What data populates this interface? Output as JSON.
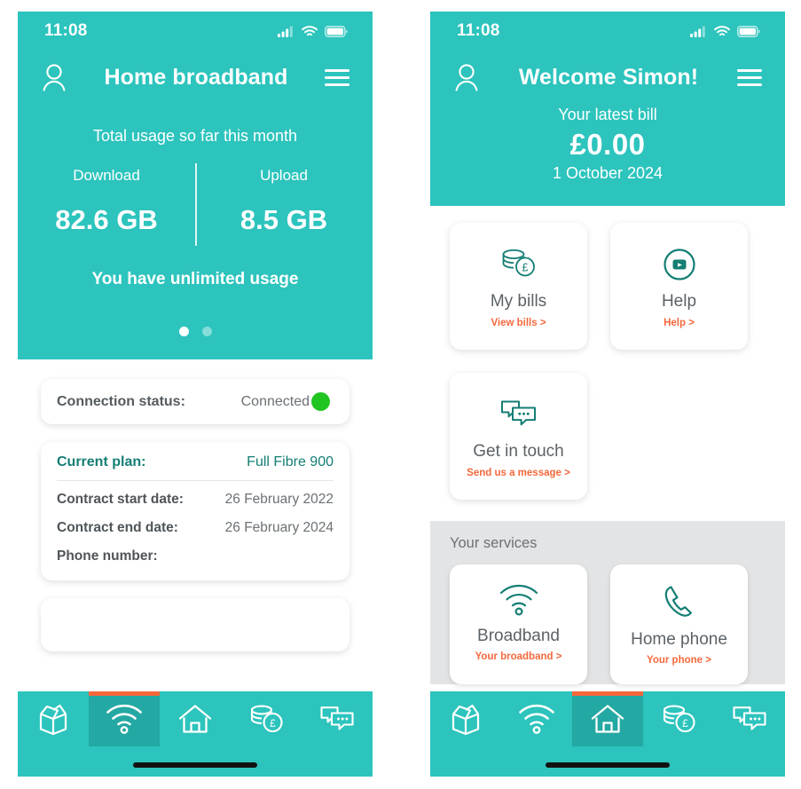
{
  "colors": {
    "teal": "#2cc4bd",
    "teal_dark": "#24a8a3",
    "icon_teal": "#147e74",
    "orange": "#f4683c",
    "green_led": "#21c521",
    "grey_band": "#e3e4e5",
    "text_grey": "#6b7175"
  },
  "left_phone": {
    "status_bar": {
      "time": "11:08",
      "icons": [
        "signal-icon",
        "wifi-icon",
        "battery-icon"
      ]
    },
    "nav": {
      "account_icon": "person-icon",
      "title": "Home broadband",
      "menu_icon": "hamburger-icon"
    },
    "usage": {
      "caption": "Total usage so far this month",
      "download_label": "Download",
      "download_value": "82.6 GB",
      "upload_label": "Upload",
      "upload_value": "8.5 GB",
      "unlimited_note": "You have unlimited usage",
      "carousel_dots": 2,
      "carousel_active_index": 0
    },
    "connection": {
      "label": "Connection status:",
      "value": "Connected",
      "led_state": "green"
    },
    "plan": {
      "plan_label": "Current plan:",
      "plan_value": "Full Fibre 900",
      "rows": [
        {
          "label": "Contract start date:",
          "value": "26 February 2022"
        },
        {
          "label": "Contract end date:",
          "value": "26 February 2024"
        },
        {
          "label": "Phone number:",
          "value": ""
        }
      ]
    },
    "tabbar": {
      "items": [
        {
          "name": "tab-products",
          "icon": "open-box-icon",
          "active": false
        },
        {
          "name": "tab-broadband",
          "icon": "wifi-icon",
          "active": true
        },
        {
          "name": "tab-home",
          "icon": "house-icon",
          "active": false
        },
        {
          "name": "tab-bills",
          "icon": "coins-pound-icon",
          "active": false
        },
        {
          "name": "tab-messages",
          "icon": "chat-bubbles-icon",
          "active": false
        }
      ]
    }
  },
  "right_phone": {
    "status_bar": {
      "time": "11:08",
      "icons": [
        "signal-icon",
        "wifi-icon",
        "battery-icon"
      ]
    },
    "nav": {
      "account_icon": "person-icon",
      "title": "Welcome Simon!",
      "menu_icon": "hamburger-icon"
    },
    "bill": {
      "caption": "Your latest bill",
      "amount": "£0.00",
      "date": "1 October 2024"
    },
    "tiles": [
      {
        "icon": "coins-pound-icon",
        "title": "My bills",
        "link": "View bills >"
      },
      {
        "icon": "play-circle-icon",
        "title": "Help",
        "link": "Help >"
      },
      {
        "icon": "chat-bubbles-icon",
        "title": "Get in touch",
        "link": "Send us a message >"
      }
    ],
    "services": {
      "title": "Your services",
      "items": [
        {
          "icon": "wifi-icon",
          "title": "Broadband",
          "link": "Your broadband >"
        },
        {
          "icon": "phone-handset-icon",
          "title": "Home phone",
          "link": "Your phone >"
        }
      ]
    },
    "tabbar": {
      "items": [
        {
          "name": "tab-products",
          "icon": "open-box-icon",
          "active": false
        },
        {
          "name": "tab-broadband",
          "icon": "wifi-icon",
          "active": false
        },
        {
          "name": "tab-home",
          "icon": "house-icon",
          "active": true
        },
        {
          "name": "tab-bills",
          "icon": "coins-pound-icon",
          "active": false
        },
        {
          "name": "tab-messages",
          "icon": "chat-bubbles-icon",
          "active": false
        }
      ]
    }
  }
}
